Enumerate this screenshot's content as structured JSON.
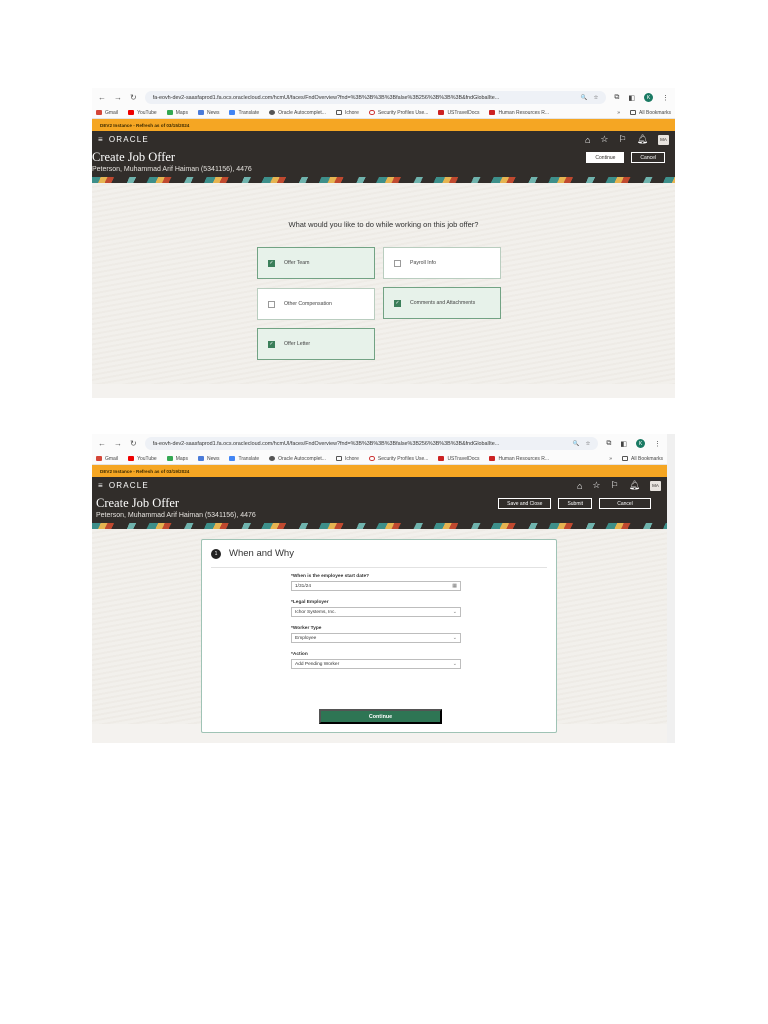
{
  "browser": {
    "url": "fa-eovh-dev2-saasfaprod1.fa.ocs.oraclecloud.com/hcmUI/faces/FndOverview?fnd=%3B%3B%3B%3Bfalse%3B256%3B%3B%3B&fndGlobalIte...",
    "bookmarks": [
      "Gmail",
      "YouTube",
      "Maps",
      "News",
      "Translate",
      "Oracle Autocomplet...",
      "Ichore",
      "Security Profiles Use...",
      "USTravelDocs",
      "Human Resources R..."
    ],
    "all_bookmarks": "All Bookmarks",
    "profile_initial": "K",
    "overflow": "»"
  },
  "shot1": {
    "banner": "DEV2 Instance - Refresh as of 03/15/2024",
    "logo": "ORACLE",
    "avatar": "MA",
    "title": "Create Job Offer",
    "subtitle": "Peterson, Muhammad Arif Haiman (5341156), 4476",
    "continue_label": "Continue",
    "cancel_label": "Cancel",
    "question": "What would you like to do while working on this job offer?",
    "options": [
      {
        "label": "Offer Team",
        "checked": true
      },
      {
        "label": "Payroll Info",
        "checked": false
      },
      {
        "label": "Other Compensation",
        "checked": false
      },
      {
        "label": "Comments and Attachments",
        "checked": true
      },
      {
        "label": "Offer Letter",
        "checked": true
      }
    ]
  },
  "shot2": {
    "banner": "DEV2 Instance - Refresh as of 03/19/2024",
    "logo": "ORACLE",
    "avatar": "MA",
    "title": "Create Job Offer",
    "subtitle": "Peterson, Muhammad Arif Haiman (5341156), 4476",
    "save_close_label": "Save and Close",
    "submit_label": "Submit",
    "cancel_label": "Cancel",
    "section_number": "1",
    "section_title": "When and Why",
    "fields": [
      {
        "label": "*When is the employee start date?",
        "value": "1/31/24"
      },
      {
        "label": "*Legal Employer",
        "value": "Ichor Systems, Inc."
      },
      {
        "label": "*Worker Type",
        "value": "Employee"
      },
      {
        "label": "*Action",
        "value": "Add Pending Worker"
      }
    ],
    "continue_label": "Continue"
  },
  "colors": {
    "header_bg": "#312d2a",
    "banner": "#f5a623",
    "accent_green": "#2e7554",
    "selected_bg": "#e7f2ea"
  }
}
